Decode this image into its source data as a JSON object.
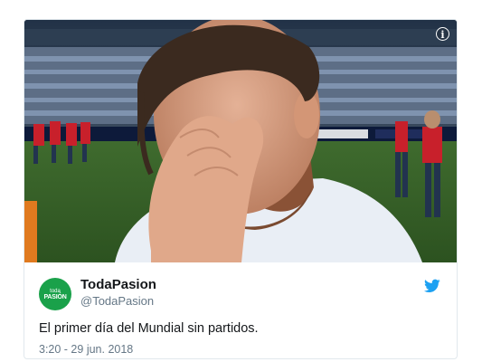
{
  "tweet": {
    "avatar_line1": "toda",
    "avatar_line2": "PASIÓN",
    "display_name": "TodaPasion",
    "handle": "@TodaPasion",
    "text": "El primer día del Mundial sin partidos.",
    "timestamp": "3:20 - 29 jun. 2018"
  },
  "media": {
    "info_icon": "i",
    "description_icon": "info-icon"
  },
  "colors": {
    "twitter_blue": "#1da1f2",
    "avatar_green": "#1aa14a",
    "text": "#14171a",
    "secondary": "#657786"
  }
}
